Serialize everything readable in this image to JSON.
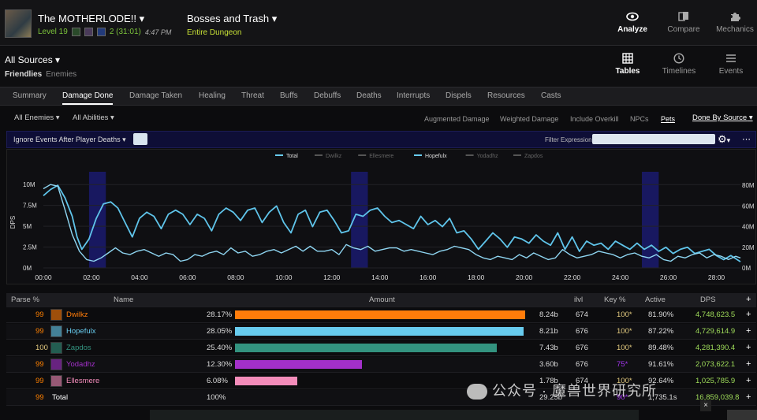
{
  "header": {
    "report_title": "The MOTHERLODE!!",
    "level": "Level 19",
    "keystone": "2 (31:01)",
    "time": "4:47 PM",
    "fight_title": "Bosses and Trash",
    "fight_sub": "Entire Dungeon",
    "nav": [
      {
        "label": "Analyze",
        "icon": "eye-icon"
      },
      {
        "label": "Compare",
        "icon": "compare-icon"
      },
      {
        "label": "Mechanics",
        "icon": "puzzle-icon"
      }
    ]
  },
  "sources": {
    "title": "All Sources",
    "friendlies": "Friendlies",
    "enemies": "Enemies",
    "views": [
      {
        "label": "Tables",
        "icon": "table-icon"
      },
      {
        "label": "Timelines",
        "icon": "clock-icon"
      },
      {
        "label": "Events",
        "icon": "list-icon"
      }
    ]
  },
  "tabs": [
    "Summary",
    "Damage Done",
    "Damage Taken",
    "Healing",
    "Threat",
    "Buffs",
    "Debuffs",
    "Deaths",
    "Interrupts",
    "Dispels",
    "Resources",
    "Casts"
  ],
  "options": {
    "enemies": "All Enemies",
    "abilities": "All Abilities",
    "toggles": [
      "Augmented Damage",
      "Weighted Damage",
      "Include Overkill",
      "NPCs",
      "Pets"
    ],
    "done_by": "Done By Source"
  },
  "filter": {
    "ignore_label": "Ignore Events After Player Deaths",
    "expression_label": "Filter Expression:"
  },
  "chart_data": {
    "type": "line",
    "ylabel": "DPS",
    "legend": [
      "Total",
      "Dwilkz",
      "Ellesmere",
      "Hopefulx",
      "Yodadhz",
      "Zapdos"
    ],
    "x_ticks": [
      "00:00",
      "02:00",
      "04:00",
      "06:00",
      "08:00",
      "10:00",
      "12:00",
      "14:00",
      "16:00",
      "18:00",
      "20:00",
      "22:00",
      "24:00",
      "26:00",
      "28:00"
    ],
    "y_left_ticks": [
      "0M",
      "2.5M",
      "5M",
      "7.5M",
      "10M"
    ],
    "y_right_ticks": [
      "0M",
      "20M",
      "40M",
      "60M",
      "80M"
    ],
    "y_left_range": [
      0,
      10.4
    ],
    "y_right_range": [
      0,
      84
    ],
    "x_range_min": [
      0,
      29
    ],
    "series": [
      {
        "name": "Total",
        "axis": "right",
        "x": [
          0,
          0.3,
          0.6,
          0.9,
          1.2,
          1.4,
          1.6,
          1.9,
          2.2,
          2.5,
          2.8,
          3.1,
          3.4,
          3.7,
          4,
          4.3,
          4.6,
          4.9,
          5.2,
          5.5,
          5.8,
          6.1,
          6.4,
          6.7,
          7,
          7.3,
          7.6,
          7.9,
          8.2,
          8.5,
          8.8,
          9.1,
          9.4,
          9.7,
          10,
          10.3,
          10.6,
          10.9,
          11.2,
          11.5,
          11.8,
          12.1,
          12.4,
          12.7,
          13,
          13.3,
          13.6,
          13.9,
          14.2,
          14.5,
          14.8,
          15.1,
          15.4,
          15.7,
          16,
          16.3,
          16.6,
          16.9,
          17.2,
          17.5,
          17.8,
          18.1,
          18.4,
          18.7,
          19,
          19.3,
          19.6,
          19.9,
          20.2,
          20.5,
          20.8,
          21.1,
          21.4,
          21.7,
          22,
          22.3,
          22.6,
          22.9,
          23.2,
          23.5,
          23.8,
          24.1,
          24.4,
          24.7,
          25,
          25.3,
          25.6,
          25.9,
          26.2,
          26.5,
          26.8,
          27.1,
          27.4,
          27.7,
          28,
          28.3,
          28.6,
          29
        ],
        "y": [
          70,
          76,
          80,
          68,
          50,
          30,
          18,
          28,
          48,
          62,
          64,
          58,
          44,
          30,
          48,
          54,
          50,
          38,
          52,
          56,
          52,
          42,
          52,
          48,
          36,
          52,
          58,
          54,
          46,
          56,
          58,
          44,
          54,
          60,
          44,
          34,
          52,
          56,
          40,
          54,
          56,
          46,
          34,
          36,
          52,
          50,
          56,
          58,
          50,
          44,
          46,
          42,
          38,
          50,
          42,
          46,
          40,
          48,
          34,
          36,
          28,
          18,
          26,
          34,
          28,
          20,
          30,
          28,
          24,
          32,
          26,
          22,
          34,
          18,
          30,
          16,
          26,
          22,
          24,
          18,
          26,
          22,
          18,
          24,
          18,
          22,
          16,
          20,
          14,
          18,
          20,
          14,
          16,
          18,
          12,
          8,
          12,
          6
        ]
      },
      {
        "name": "Hopefulx",
        "axis": "left",
        "x": [
          0,
          0.3,
          0.6,
          0.9,
          1.2,
          1.5,
          1.8,
          2.1,
          2.4,
          2.7,
          3,
          3.3,
          3.6,
          3.9,
          4.2,
          4.5,
          4.8,
          5.1,
          5.4,
          5.7,
          6,
          6.3,
          6.6,
          6.9,
          7.2,
          7.5,
          7.8,
          8.1,
          8.4,
          8.7,
          9,
          9.3,
          9.6,
          9.9,
          10.2,
          10.5,
          10.8,
          11.1,
          11.4,
          11.7,
          12,
          12.3,
          12.6,
          12.9,
          13.2,
          13.5,
          13.8,
          14.1,
          14.4,
          14.7,
          15,
          15.3,
          15.6,
          15.9,
          16.2,
          16.5,
          16.8,
          17.1,
          17.4,
          17.7,
          18,
          18.3,
          18.6,
          18.9,
          19.2,
          19.5,
          19.8,
          20.1,
          20.4,
          20.7,
          21,
          21.3,
          21.6,
          21.9,
          22.2,
          22.5,
          22.8,
          23.1,
          23.4,
          23.7,
          24,
          24.3,
          24.6,
          24.9,
          25.2,
          25.5,
          25.8,
          26.1,
          26.4,
          26.7,
          27,
          27.3,
          27.6,
          27.9,
          28.2,
          28.5,
          28.8,
          29
        ],
        "y": [
          9.5,
          10,
          9.8,
          7,
          4,
          2,
          1,
          0.8,
          1.2,
          1.8,
          2.4,
          1.8,
          1.6,
          2,
          2.2,
          1.8,
          1.4,
          1.8,
          1.6,
          0.8,
          1,
          1.6,
          1.4,
          1.8,
          2,
          1.6,
          2.4,
          1.8,
          2,
          1.4,
          1.6,
          2,
          2.2,
          1.8,
          2.2,
          2.6,
          2,
          2.6,
          2,
          2,
          2.2,
          1.6,
          2.8,
          2.4,
          2.2,
          2.6,
          2,
          2.2,
          2.4,
          2.4,
          2,
          2.2,
          2,
          1.8,
          1.6,
          2,
          2.2,
          2.6,
          2.4,
          2.2,
          1.6,
          1.2,
          1,
          1.4,
          1.2,
          1,
          1.6,
          1.2,
          1.8,
          1.4,
          1,
          1.2,
          2.2,
          1.6,
          1.2,
          1.4,
          1.6,
          2,
          1.8,
          1.6,
          1.2,
          1.6,
          1.8,
          1.4,
          1.2,
          1.6,
          1,
          0.8,
          1.4,
          1.2,
          1.6,
          1.8,
          1.2,
          1.6,
          1.4,
          1,
          1.4,
          1.2
        ]
      }
    ],
    "shaded_regions_min": [
      [
        1.9,
        2.6
      ],
      [
        12.8,
        13.5
      ],
      [
        24.9,
        25.6
      ]
    ]
  },
  "table": {
    "headers": [
      "Parse %",
      "Name",
      "Amount",
      "ilvl",
      "Key %",
      "Active",
      "DPS"
    ],
    "rows": [
      {
        "parse": "99",
        "name": "Dwilkz",
        "name_color": "#ff7c0a",
        "pct": "28.17%",
        "bar_fraction": 0.2817,
        "bar_color": "#ff7c0a",
        "amount": "8.24b",
        "ilvl": "674",
        "key": "100*",
        "key_color": "#e5cc80",
        "active": "81.90%",
        "dps": "4,748,623.5",
        "parse_color": "#ff8000"
      },
      {
        "parse": "99",
        "name": "Hopefulx",
        "name_color": "#68ccef",
        "pct": "28.05%",
        "bar_fraction": 0.2805,
        "bar_color": "#68ccef",
        "amount": "8.21b",
        "ilvl": "676",
        "key": "100*",
        "key_color": "#e5cc80",
        "active": "87.22%",
        "dps": "4,729,614.9",
        "parse_color": "#ff8000"
      },
      {
        "parse": "100",
        "name": "Zapdos",
        "name_color": "#33937f",
        "pct": "25.40%",
        "bar_fraction": 0.254,
        "bar_color": "#33937f",
        "amount": "7.43b",
        "ilvl": "676",
        "key": "100*",
        "key_color": "#e5cc80",
        "active": "89.48%",
        "dps": "4,281,390.4",
        "parse_color": "#e5cc80"
      },
      {
        "parse": "99",
        "name": "Yodadhz",
        "name_color": "#a330c9",
        "pct": "12.30%",
        "bar_fraction": 0.123,
        "bar_color": "#a330c9",
        "amount": "3.60b",
        "ilvl": "676",
        "key": "75*",
        "key_color": "#a335ee",
        "active": "91.61%",
        "dps": "2,073,622.1",
        "parse_color": "#ff8000"
      },
      {
        "parse": "99",
        "name": "Ellesmere",
        "name_color": "#f48cba",
        "pct": "6.08%",
        "bar_fraction": 0.0608,
        "bar_color": "#f48cba",
        "amount": "1.78b",
        "ilvl": "674",
        "key": "100*",
        "key_color": "#e5cc80",
        "active": "92.64%",
        "dps": "1,025,785.9",
        "parse_color": "#ff8000"
      },
      {
        "parse": "99",
        "name": "Total",
        "name_color": "#ffffff",
        "pct": "100%",
        "bar_fraction": 0,
        "bar_color": "#000000",
        "amount": "29.25b",
        "ilvl": "",
        "key": "90*",
        "key_color": "#a335ee",
        "active": "1,735.1s",
        "dps": "16,859,039.8",
        "parse_color": "#ff8000"
      }
    ]
  },
  "watermark": "公众号 · 魔兽世界研究所"
}
